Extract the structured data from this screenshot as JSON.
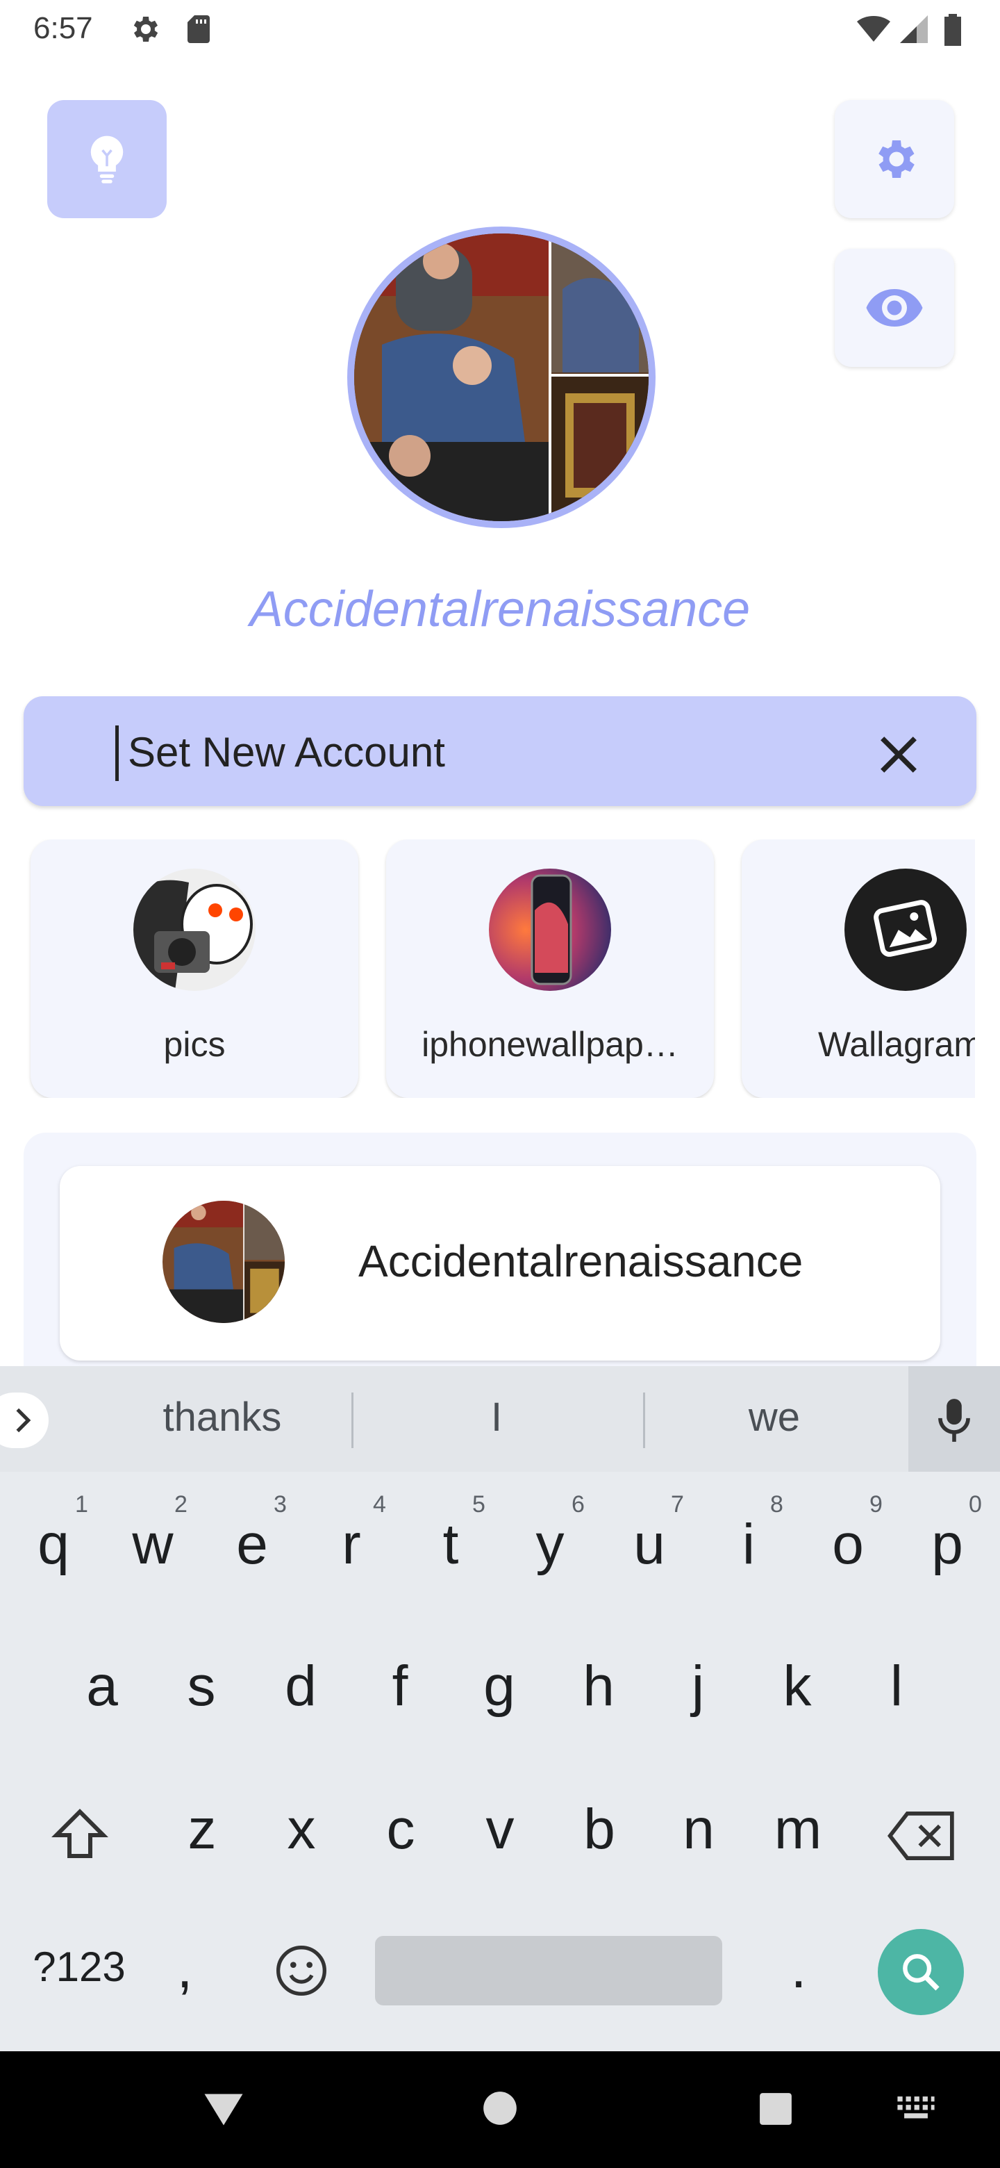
{
  "status_bar": {
    "time": "6:57",
    "icons": [
      "gear-icon",
      "sd-card-icon",
      "wifi-icon",
      "signal-icon",
      "battery-icon"
    ]
  },
  "top_actions": {
    "left": "bulb-icon",
    "right": [
      "gear-icon",
      "eye-icon"
    ]
  },
  "profile": {
    "name": "Accidentalrenaissance"
  },
  "search": {
    "value": "Set New Account",
    "clear_icon": "close-icon"
  },
  "chips": [
    {
      "label": "pics"
    },
    {
      "label": "iphonewallpap…"
    },
    {
      "label": "Wallagram"
    }
  ],
  "results": [
    {
      "name": "Accidentalrenaissance"
    }
  ],
  "keyboard": {
    "suggestions": [
      "thanks",
      "I",
      "we"
    ],
    "row1": [
      "q",
      "w",
      "e",
      "r",
      "t",
      "y",
      "u",
      "i",
      "o",
      "p"
    ],
    "row1_numbers": [
      "1",
      "2",
      "3",
      "4",
      "5",
      "6",
      "7",
      "8",
      "9",
      "0"
    ],
    "row2": [
      "a",
      "s",
      "d",
      "f",
      "g",
      "h",
      "j",
      "k",
      "l"
    ],
    "row3": [
      "z",
      "x",
      "c",
      "v",
      "b",
      "n",
      "m"
    ],
    "symbols_key": "?123",
    "comma": ",",
    "period": "."
  },
  "colors": {
    "accent": "#8f9cf4",
    "field": "#c6ccfb",
    "card": "#f3f5fd",
    "search_key": "#4db6a5"
  }
}
